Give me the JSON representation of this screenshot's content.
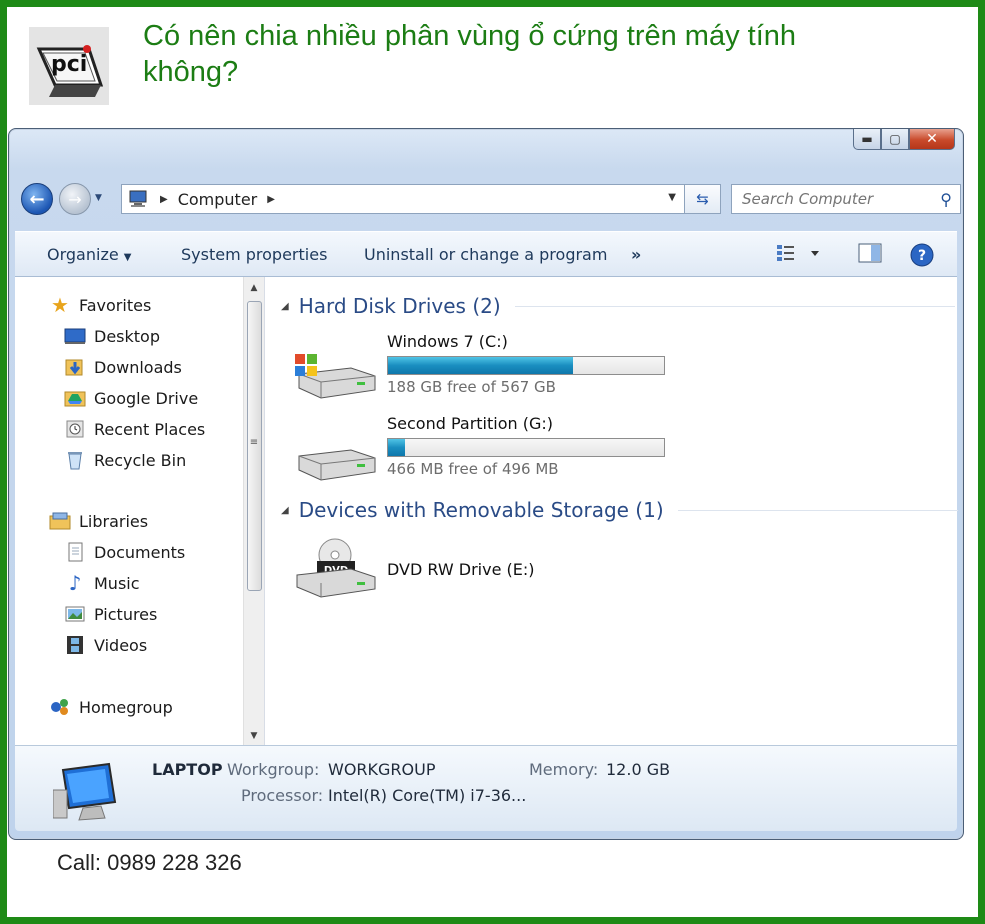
{
  "headline": "Có nên chia nhiều phân vùng ổ cứng trên máy tính không?",
  "logo_text": "pci",
  "phone": "Call: 0989 228 326",
  "colors": {
    "frame": "#1e8a16",
    "headline": "#1c7d14",
    "group_header": "#2a4b86",
    "bar_fill": "#1a8ec0"
  },
  "window": {
    "controls": {
      "minimize": "▬",
      "maximize": "▢",
      "close": "✕"
    },
    "address": {
      "location": "Computer",
      "separator_icon": "chevron-right"
    },
    "search": {
      "placeholder": "Search Computer"
    },
    "toolbar": {
      "organize": "Organize",
      "system_properties": "System properties",
      "uninstall": "Uninstall or change a program",
      "more": "»"
    }
  },
  "sidebar": {
    "favorites_label": "Favorites",
    "favorites": [
      "Desktop",
      "Downloads",
      "Google Drive",
      "Recent Places",
      "Recycle Bin"
    ],
    "libraries_label": "Libraries",
    "libraries": [
      "Documents",
      "Music",
      "Pictures",
      "Videos"
    ],
    "homegroup": "Homegroup"
  },
  "groups": {
    "hdd": "Hard Disk Drives (2)",
    "removable": "Devices with Removable Storage (1)"
  },
  "drives": [
    {
      "name": "Windows 7 (C:)",
      "free": "188 GB free of 567 GB",
      "used_fraction": 0.67
    },
    {
      "name": "Second Partition (G:)",
      "free": "466 MB free of 496 MB",
      "used_fraction": 0.06
    }
  ],
  "dvd": {
    "name": "DVD RW Drive (E:)",
    "badge": "DVD"
  },
  "details": {
    "computer_name": "LAPTOP",
    "workgroup_label": "Workgroup:",
    "workgroup": "WORKGROUP",
    "memory_label": "Memory:",
    "memory": "12.0 GB",
    "processor_label": "Processor:",
    "processor": "Intel(R) Core(TM) i7-36..."
  }
}
